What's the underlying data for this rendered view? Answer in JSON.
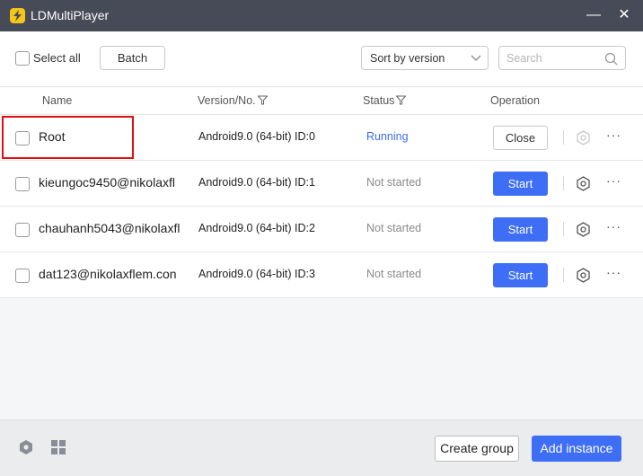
{
  "window": {
    "title": "LDMultiPlayer",
    "minimize_symbol": "—",
    "close_symbol": "✕"
  },
  "toolbar": {
    "select_all_label": "Select all",
    "batch_label": "Batch",
    "sort_value": "Sort by version",
    "search_placeholder": "Search"
  },
  "table": {
    "headers": {
      "name": "Name",
      "version": "Version/No.",
      "status": "Status",
      "operation": "Operation"
    },
    "rows": [
      {
        "name": "Root",
        "version": "Android9.0 (64-bit) ID:0",
        "status": "Running",
        "action": "Close"
      },
      {
        "name": "kieungoc9450@nikolaxfl",
        "version": "Android9.0 (64-bit) ID:1",
        "status": "Not started",
        "action": "Start"
      },
      {
        "name": "chauhanh5043@nikolaxfl",
        "version": "Android9.0 (64-bit) ID:2",
        "status": "Not started",
        "action": "Start"
      },
      {
        "name": "dat123@nikolaxflem.con",
        "version": "Android9.0 (64-bit) ID:3",
        "status": "Not started",
        "action": "Start"
      }
    ],
    "more_symbol": "···"
  },
  "footer": {
    "create_group_label": "Create group",
    "add_instance_label": "Add instance"
  },
  "colors": {
    "accent": "#3d6ef5",
    "titlebar": "#474a57",
    "logo": "#f5c518",
    "highlight": "#e01010"
  },
  "icons": [
    "lightning-logo-icon",
    "minimize-icon",
    "close-icon",
    "chevron-down-icon",
    "search-icon",
    "filter-icon",
    "gear-icon",
    "more-icon",
    "grid-icon"
  ]
}
